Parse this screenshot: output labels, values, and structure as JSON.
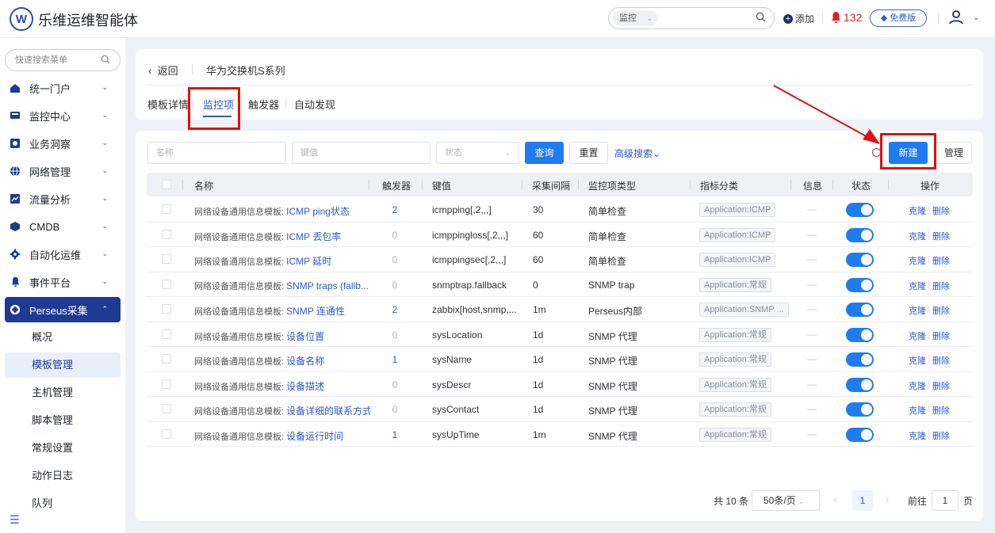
{
  "app": {
    "logo_letter": "W",
    "title": "乐维运维智能体"
  },
  "header": {
    "search_scope": "监控",
    "search_placeholder": "",
    "add_label": "添加",
    "alert_count": "132",
    "edition_label": "免费版"
  },
  "sidebar": {
    "search_placeholder": "快速搜索菜单",
    "items": [
      {
        "label": "统一门户",
        "icon": "home-icon"
      },
      {
        "label": "监控中心",
        "icon": "monitor-icon"
      },
      {
        "label": "业务洞察",
        "icon": "insight-icon"
      },
      {
        "label": "网络管理",
        "icon": "globe-icon"
      },
      {
        "label": "流量分析",
        "icon": "chart-icon"
      },
      {
        "label": "CMDB",
        "icon": "cube-icon"
      },
      {
        "label": "自动化运维",
        "icon": "gear-icon"
      },
      {
        "label": "事件平台",
        "icon": "bell-icon"
      },
      {
        "label": "Perseus采集",
        "icon": "perseus-icon"
      }
    ],
    "sub_items": [
      "概况",
      "模板管理",
      "主机管理",
      "脚本管理",
      "常规设置",
      "动作日志",
      "队列"
    ]
  },
  "breadcrumb": {
    "back": "返回",
    "template_name": "华为交换机S系列"
  },
  "tabs": [
    "模板详情",
    "监控项",
    "触发器",
    "自动发现"
  ],
  "filters": {
    "name_placeholder": "名称",
    "key_placeholder": "键值",
    "status_placeholder": "状态",
    "query": "查询",
    "reset": "重置",
    "advanced": "高级搜索",
    "new": "新建",
    "manage": "管理"
  },
  "table": {
    "columns": [
      "名称",
      "触发器",
      "键值",
      "采集间隔",
      "监控项类型",
      "指标分类",
      "信息",
      "状态",
      "操作"
    ],
    "rows": [
      {
        "prefix": "网络设备通用信息模板: ",
        "name": "ICMP ping状态",
        "triggers": "2",
        "key": "icmpping[,2,,,]",
        "interval": "30",
        "type": "简单检查",
        "category": "Application:ICMP",
        "info": "—",
        "clone": "克隆",
        "delete": "删除"
      },
      {
        "prefix": "网络设备通用信息模板: ",
        "name": "ICMP 丢包率",
        "triggers": "0",
        "key": "icmppingloss[,2,,,]",
        "interval": "60",
        "type": "简单检查",
        "category": "Application:ICMP",
        "info": "—",
        "clone": "克隆",
        "delete": "删除"
      },
      {
        "prefix": "网络设备通用信息模板: ",
        "name": "ICMP 延时",
        "triggers": "0",
        "key": "icmppingsec[,2,,,]",
        "interval": "60",
        "type": "简单检查",
        "category": "Application:ICMP",
        "info": "—",
        "clone": "克隆",
        "delete": "删除"
      },
      {
        "prefix": "网络设备通用信息模板: ",
        "name": "SNMP traps (fallb...",
        "triggers": "0",
        "key": "snmptrap.fallback",
        "interval": "0",
        "type": "SNMP trap",
        "category": "Application:常规",
        "info": "—",
        "clone": "克隆",
        "delete": "删除"
      },
      {
        "prefix": "网络设备通用信息模板: ",
        "name": "SNMP 连通性",
        "triggers": "2",
        "key": "zabbix[host,snmp,...",
        "interval": "1m",
        "type": "Perseus内部",
        "category": "Application:SNMP ...",
        "info": "—",
        "clone": "克隆",
        "delete": "删除"
      },
      {
        "prefix": "网络设备通用信息模板: ",
        "name": "设备位置",
        "triggers": "0",
        "key": "sysLocation",
        "interval": "1d",
        "type": "SNMP 代理",
        "category": "Application:常规",
        "info": "—",
        "clone": "克隆",
        "delete": "删除"
      },
      {
        "prefix": "网络设备通用信息模板: ",
        "name": "设备名称",
        "triggers": "1",
        "key": "sysName",
        "interval": "1d",
        "type": "SNMP 代理",
        "category": "Application:常规",
        "info": "—",
        "clone": "克隆",
        "delete": "删除"
      },
      {
        "prefix": "网络设备通用信息模板: ",
        "name": "设备描述",
        "triggers": "0",
        "key": "sysDescr",
        "interval": "1d",
        "type": "SNMP 代理",
        "category": "Application:常规",
        "info": "—",
        "clone": "克隆",
        "delete": "删除"
      },
      {
        "prefix": "网络设备通用信息模板: ",
        "name": "设备详细的联系方式",
        "triggers": "0",
        "key": "sysContact",
        "interval": "1d",
        "type": "SNMP 代理",
        "category": "Application:常规",
        "info": "—",
        "clone": "克隆",
        "delete": "删除"
      },
      {
        "prefix": "网络设备通用信息模板: ",
        "name": "设备运行时间",
        "triggers": "1",
        "key": "sysUpTime",
        "interval": "1m",
        "type": "SNMP 代理",
        "category": "Application:常规",
        "info": "—",
        "clone": "克隆",
        "delete": "删除"
      }
    ]
  },
  "pagination": {
    "total": "共 10 条",
    "page_size": "50条/页",
    "current": "1",
    "goto_label": "前往",
    "goto_value": "1",
    "page_suffix": "页"
  },
  "colors": {
    "accent": "#1f7cf0",
    "sidebar_active": "#1f3a93",
    "annotation": "#e01010"
  }
}
